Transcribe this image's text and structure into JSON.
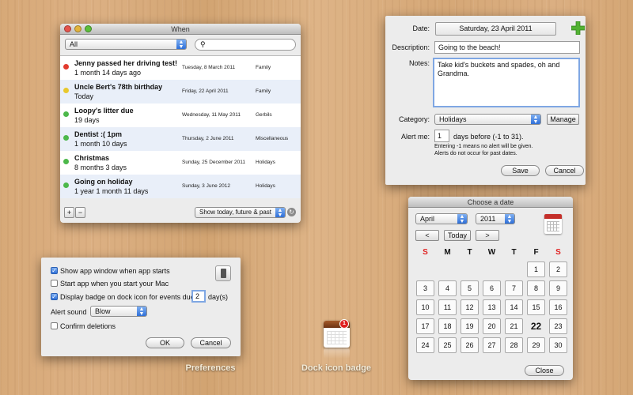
{
  "when_window": {
    "title": "When",
    "filter_value": "All",
    "search_value": "",
    "rows": [
      {
        "title": "Jenny passed her driving test!",
        "subtitle": "1 month 14 days ago",
        "date": "Tuesday, 8 March 2011",
        "category": "Family",
        "status_color": "#e23b2e"
      },
      {
        "title": "Uncle Bert's 78th birthday",
        "subtitle": "Today",
        "date": "Friday, 22 April 2011",
        "category": "Family",
        "status_color": "#e8c82d"
      },
      {
        "title": "Loopy's litter due",
        "subtitle": "19 days",
        "date": "Wednesday, 11 May 2011",
        "category": "Gerbils",
        "status_color": "#4cb84a"
      },
      {
        "title": "Dentist :(  1pm",
        "subtitle": "1 month 10 days",
        "date": "Thursday, 2 June 2011",
        "category": "Miscellaneous",
        "status_color": "#4cb84a"
      },
      {
        "title": "Christmas",
        "subtitle": "8 months 3 days",
        "date": "Sunday, 25 December 2011",
        "category": "Holidays",
        "status_color": "#4cb84a"
      },
      {
        "title": "Going on holiday",
        "subtitle": "1 year 1 month 11 days",
        "date": "Sunday, 3 June 2012",
        "category": "Holidays",
        "status_color": "#4cb84a"
      }
    ],
    "add_label": "+",
    "remove_label": "−",
    "show_value": "Show today, future & past"
  },
  "editor": {
    "date_label": "Date:",
    "date_value": "Saturday, 23 April 2011",
    "description_label": "Description:",
    "description_value": "Going to the beach!",
    "notes_label": "Notes:",
    "notes_value": "Take kid's buckets and spades, oh and Grandma.",
    "category_label": "Category:",
    "category_value": "Holidays",
    "manage_label": "Manage",
    "alert_label": "Alert me:",
    "alert_value": "1",
    "alert_suffix": "days before (-1 to 31).",
    "hint_line1": "Entering -1 means no alert will be given.",
    "hint_line2": "Alerts do not occur for past dates.",
    "save_label": "Save",
    "cancel_label": "Cancel"
  },
  "preferences": {
    "opt1": "Show app window when app starts",
    "opt1_checked": true,
    "opt2": "Start app when you start your Mac",
    "opt2_checked": false,
    "opt3": "Display badge on dock icon for events due in",
    "opt3_checked": true,
    "opt3_days": "2",
    "opt3_suffix": "day(s)",
    "sound_label": "Alert sound",
    "sound_value": "Blow",
    "opt4": "Confirm deletions",
    "opt4_checked": false,
    "ok_label": "OK",
    "cancel_label": "Cancel"
  },
  "calendar": {
    "title": "Choose a date",
    "month_value": "April",
    "year_value": "2011",
    "prev_label": "<",
    "today_label": "Today",
    "next_label": ">",
    "weekdays": [
      "S",
      "M",
      "T",
      "W",
      "T",
      "F",
      "S"
    ],
    "days": [
      "1",
      "2",
      "3",
      "4",
      "5",
      "6",
      "7",
      "8",
      "9",
      "10",
      "11",
      "12",
      "13",
      "14",
      "15",
      "16",
      "17",
      "18",
      "19",
      "20",
      "21",
      "22",
      "23",
      "24",
      "25",
      "26",
      "27",
      "28",
      "29",
      "30"
    ],
    "first_weekday": 5,
    "today": "22",
    "close_label": "Close",
    "weekend_color": "#e02020"
  },
  "captions": {
    "preferences": "Preferences",
    "dock": "Dock icon badge"
  },
  "dock_badge_count": "1"
}
